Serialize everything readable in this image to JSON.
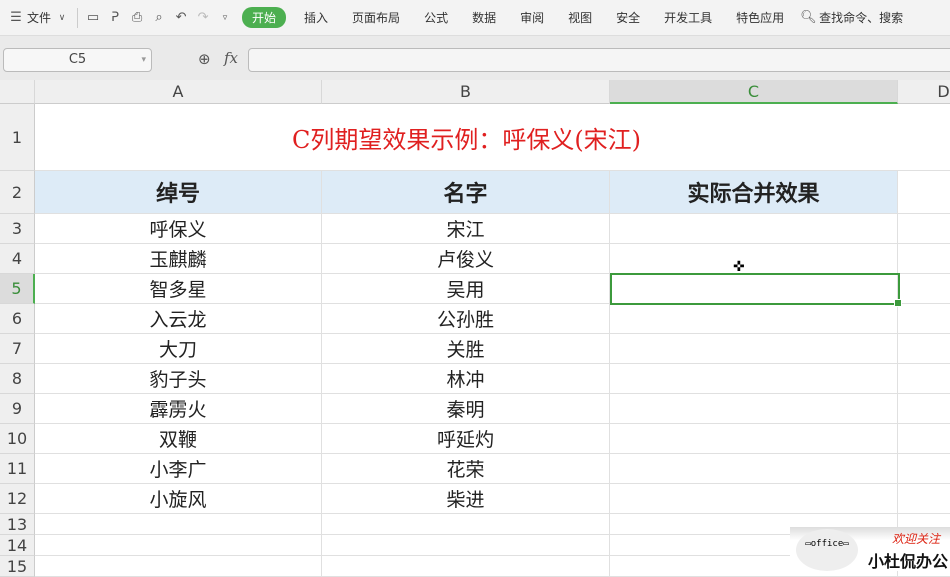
{
  "menubar": {
    "file": "文件",
    "tabs": [
      "开始",
      "插入",
      "页面布局",
      "公式",
      "数据",
      "审阅",
      "视图",
      "安全",
      "开发工具",
      "特色应用"
    ],
    "search": "查找命令、搜索"
  },
  "formula_bar": {
    "name_box": "C5",
    "fx": "fx",
    "value": ""
  },
  "columns": [
    "A",
    "B",
    "C",
    "D"
  ],
  "rows": [
    "1",
    "2",
    "3",
    "4",
    "5",
    "6",
    "7",
    "8",
    "9",
    "10",
    "11",
    "12",
    "13",
    "14",
    "15"
  ],
  "sheet": {
    "title": "C列期望效果示例：呼保义(宋江)",
    "headers": [
      "绰号",
      "名字",
      "实际合并效果"
    ],
    "data": [
      [
        "呼保义",
        "宋江"
      ],
      [
        "玉麒麟",
        "卢俊义"
      ],
      [
        "智多星",
        "吴用"
      ],
      [
        "入云龙",
        "公孙胜"
      ],
      [
        "大刀",
        "关胜"
      ],
      [
        "豹子头",
        "林冲"
      ],
      [
        "霹雳火",
        "秦明"
      ],
      [
        "双鞭",
        "呼延灼"
      ],
      [
        "小李广",
        "花荣"
      ],
      [
        "小旋风",
        "柴进"
      ]
    ]
  },
  "watermark": {
    "logo": "office",
    "line1": "欢迎关注",
    "line2": "小杜侃办公"
  }
}
